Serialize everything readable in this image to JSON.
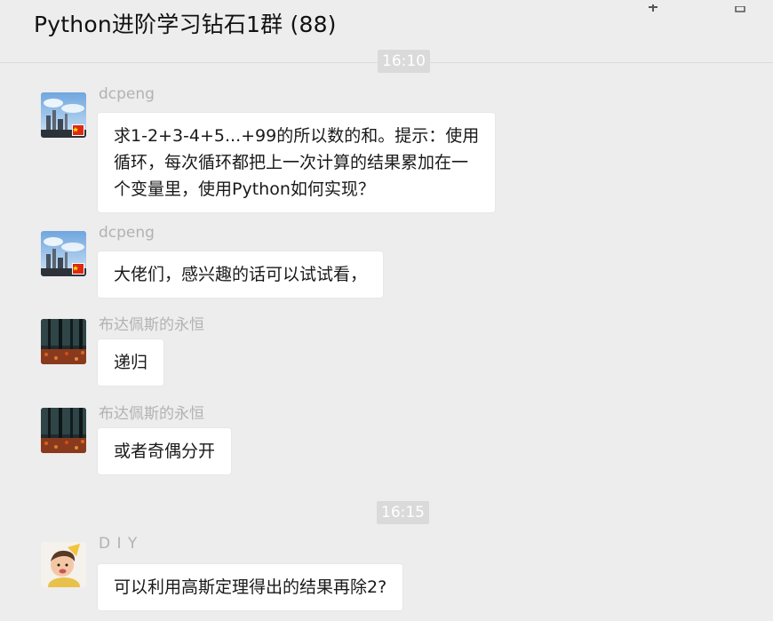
{
  "header": {
    "title": "Python进阶学习钻石1群 (88)"
  },
  "timestamps": {
    "top": "16:10",
    "mid": "16:15"
  },
  "messages": [
    {
      "sender": "dcpeng",
      "avatar_icon": "city-sky-flag-avatar",
      "lines": [
        "求1-2+3-4+5...+99的所以数的和。提示：使用",
        "循环，每次循环都把上一次计算的结果累加在一",
        "个变量里，使用Python如何实现？"
      ]
    },
    {
      "sender": "dcpeng",
      "avatar_icon": "city-sky-flag-avatar",
      "lines": [
        "大佬们，感兴趣的话可以试试看，"
      ]
    },
    {
      "sender": "布达佩斯的永恒",
      "avatar_icon": "forest-autumn-avatar",
      "lines": [
        "递归"
      ]
    },
    {
      "sender": "布达佩斯的永恒",
      "avatar_icon": "forest-autumn-avatar",
      "lines": [
        "或者奇偶分开"
      ]
    },
    {
      "sender": "D I Y",
      "avatar_icon": "child-portrait-avatar",
      "lines": [
        "可以利用高斯定理得出的结果再除2?"
      ]
    }
  ],
  "colors": {
    "background": "#ededed",
    "bubble": "#ffffff",
    "time_chip": "#dadada",
    "sender_name": "#b2b2b2"
  }
}
